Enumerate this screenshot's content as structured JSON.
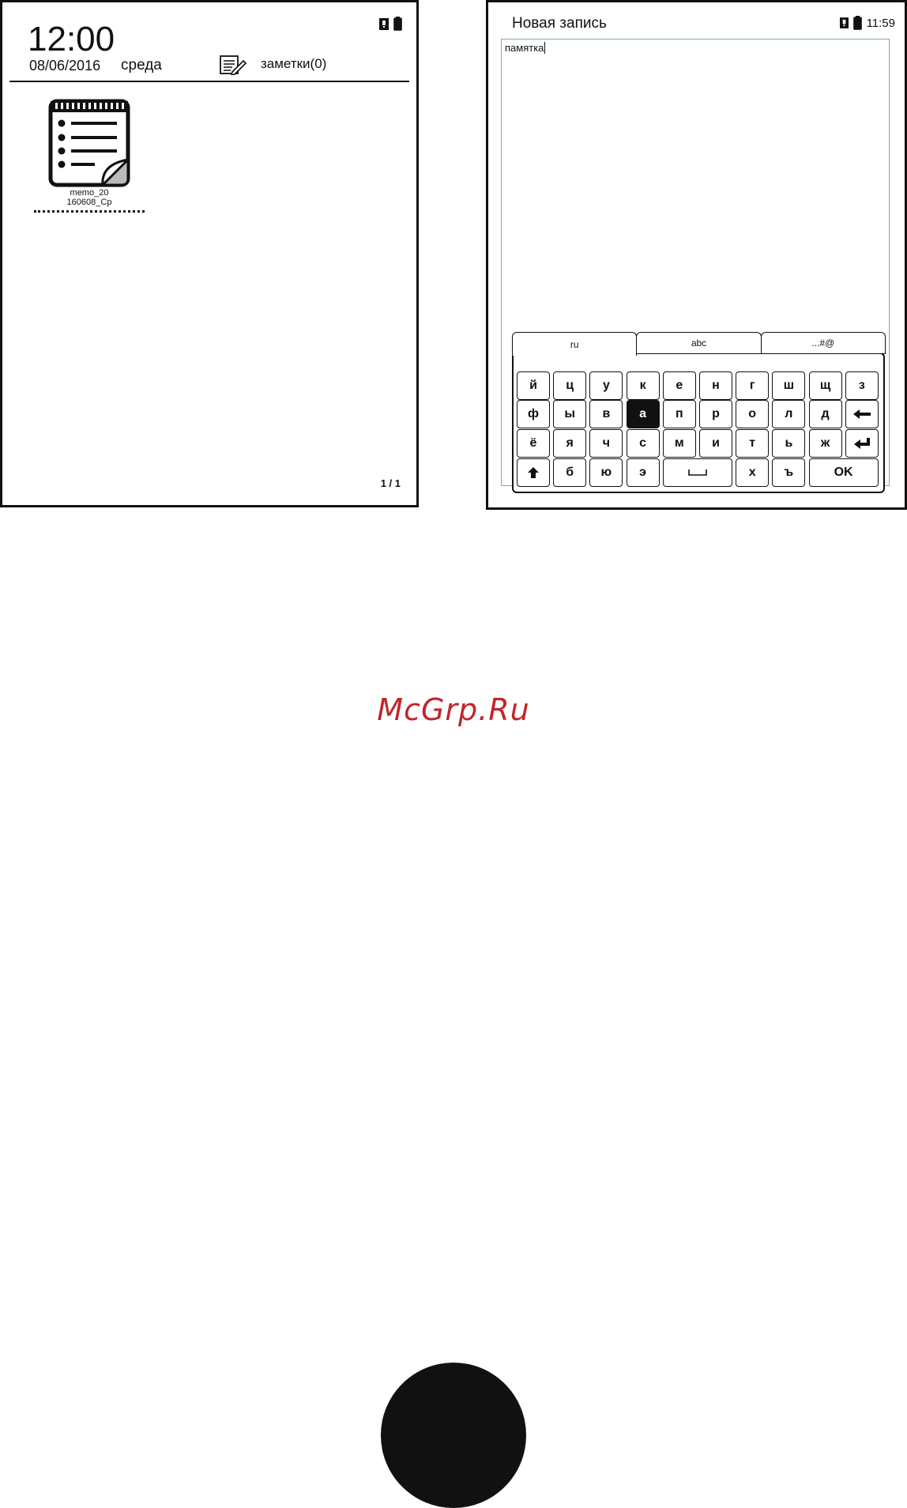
{
  "left_screen": {
    "time": "12:00",
    "date": "08/06/2016",
    "weekday": "среда",
    "notes_label": "заметки(0)",
    "memo": {
      "name_line1": "memo_20",
      "name_line2": "160608_Ср"
    },
    "page_indicator": "1 / 1",
    "icons": [
      "sd-card-icon",
      "battery-icon",
      "notes-icon",
      "memo-file-icon"
    ]
  },
  "right_screen": {
    "title": "Новая запись",
    "time": "11:59",
    "note_text": "памятка",
    "keyboard": {
      "tabs": [
        {
          "label": "ru",
          "active": true
        },
        {
          "label": "abc",
          "active": false
        },
        {
          "label": "...#@",
          "active": false
        }
      ],
      "row1": [
        "й",
        "ц",
        "у",
        "к",
        "е",
        "н",
        "г",
        "ш",
        "щ",
        "з"
      ],
      "row2": [
        "ф",
        "ы",
        "в",
        "а",
        "п",
        "р",
        "о",
        "л",
        "д"
      ],
      "row3": [
        "ё",
        "я",
        "ч",
        "с",
        "м",
        "и",
        "т",
        "ь",
        "ж"
      ],
      "row4_letters": [
        "б",
        "ю",
        "э"
      ],
      "row4_letters_right": [
        "х",
        "ъ"
      ],
      "ok_label": "OK",
      "pressed_key": "а",
      "icons": [
        "backspace-icon",
        "enter-icon",
        "shift-icon",
        "space-icon"
      ]
    }
  },
  "watermark": "McGrp.Ru",
  "colors": {
    "watermark": "#c0262b",
    "ink": "#111111",
    "text_area_border": "#7aa7c7"
  }
}
